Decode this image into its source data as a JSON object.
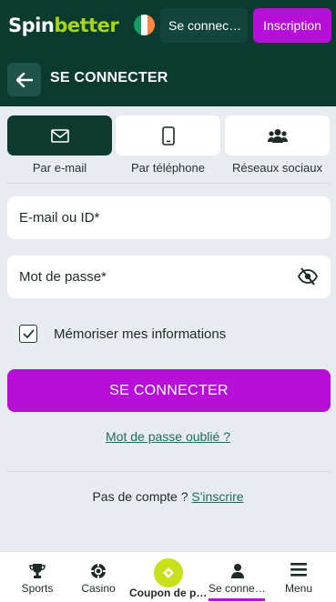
{
  "header": {
    "logo_part1": "Spin",
    "logo_part2": "better",
    "login_label": "Se connec…",
    "register_label": "Inscription",
    "flag_colors": [
      "#169b62",
      "#ffffff",
      "#ff883e"
    ]
  },
  "titlebar": {
    "back_icon": "arrow-left-icon",
    "title": "SE CONNECTER"
  },
  "tabs": [
    {
      "label": "Par e-mail",
      "icon": "envelope-icon",
      "active": true
    },
    {
      "label": "Par téléphone",
      "icon": "phone-icon",
      "active": false
    },
    {
      "label": "Réseaux sociaux",
      "icon": "users-icon",
      "active": false
    }
  ],
  "form": {
    "email_placeholder": "E-mail ou ID*",
    "password_placeholder": "Mot de passe*",
    "remember_label": "Mémoriser mes informations",
    "remember_checked": true,
    "submit_label": "SE CONNECTER",
    "forgot_label": "Mot de passe oublié ?",
    "no_account_text": "Pas de compte ?",
    "signup_link": "S'inscrire"
  },
  "bottom_nav": [
    {
      "label": "Sports",
      "icon": "trophy-icon"
    },
    {
      "label": "Casino",
      "icon": "chip-icon"
    },
    {
      "label": "Coupon de pari",
      "icon": "ticket-icon"
    },
    {
      "label": "Se connec…",
      "icon": "user-icon",
      "active": true
    },
    {
      "label": "Menu",
      "icon": "hamburger-icon"
    }
  ],
  "colors": {
    "header_bg": "#0b3a2f",
    "accent_purple": "#b80fd8",
    "logo_green": "#a8d614",
    "link_green": "#1b6e5a",
    "coupon_yellow": "#c6e01a"
  }
}
